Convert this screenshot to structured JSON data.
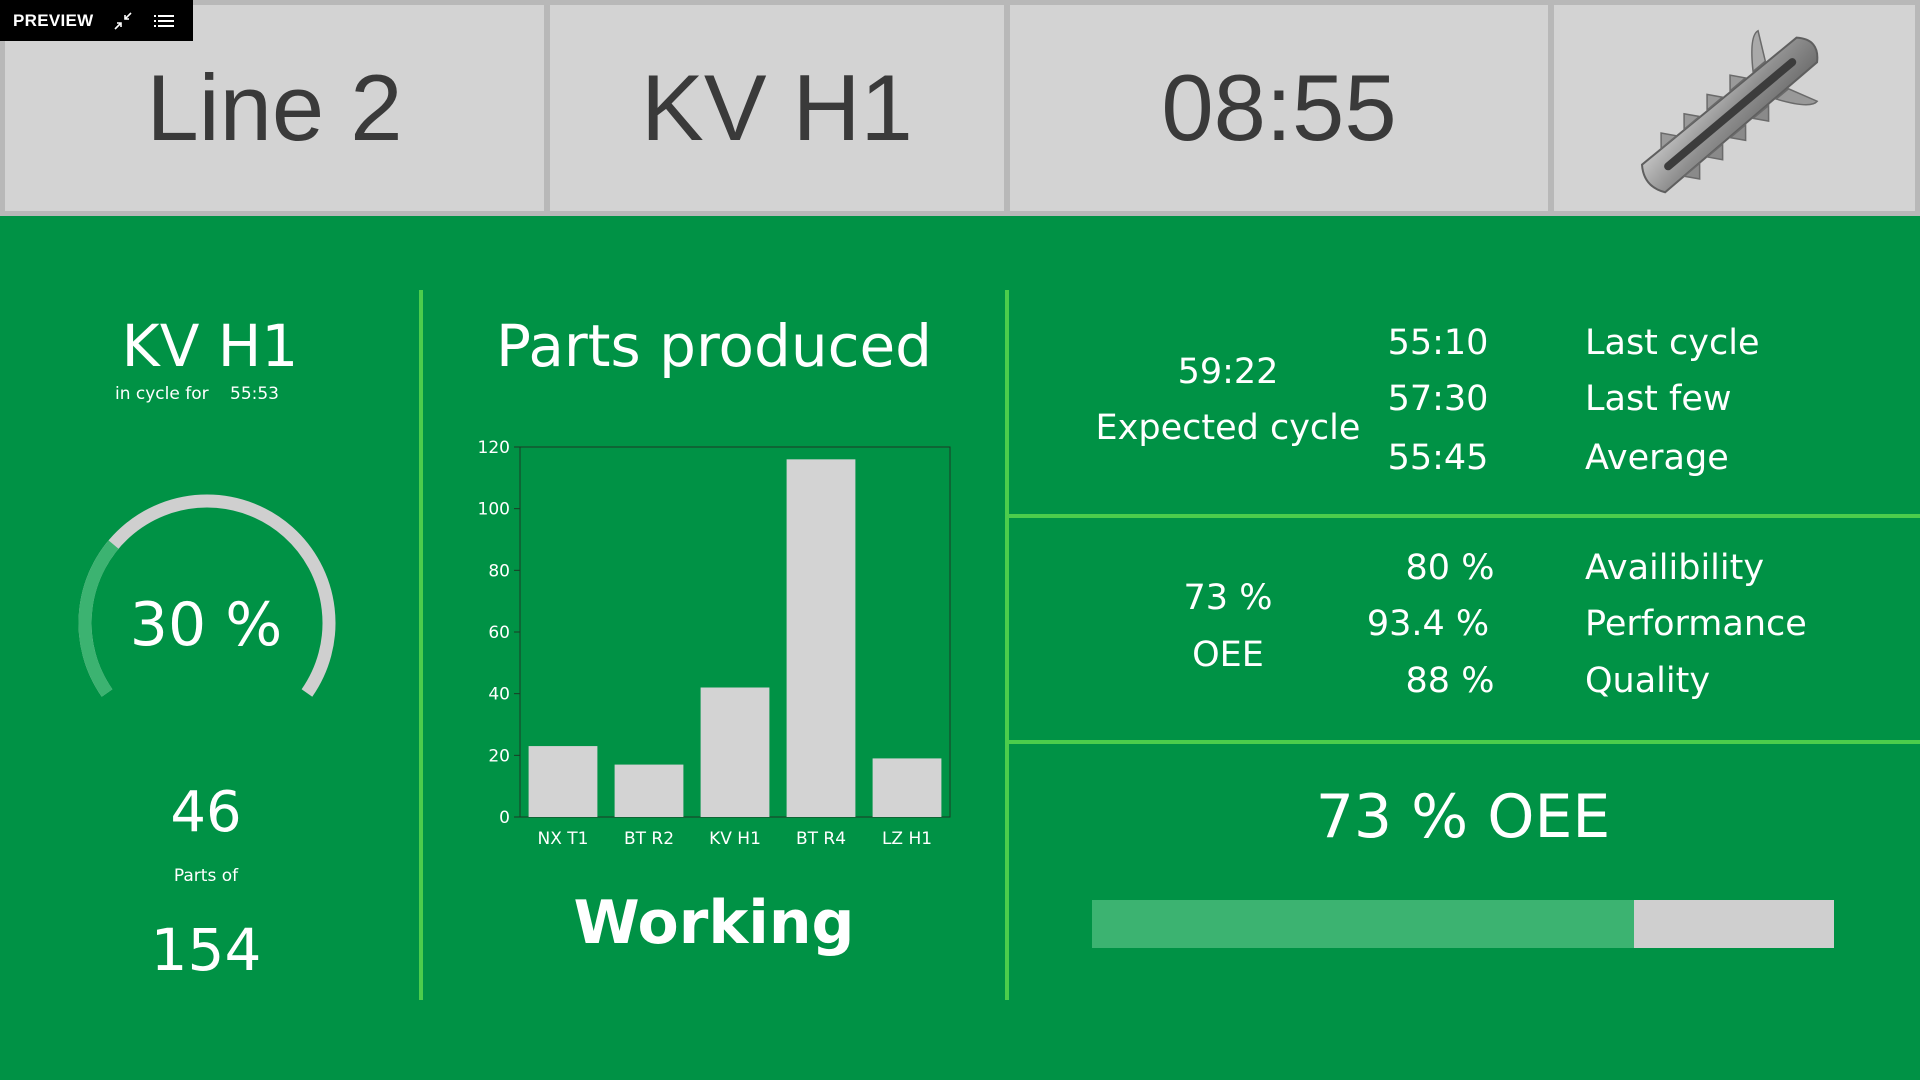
{
  "preview": {
    "label": "PREVIEW",
    "collapse_icon": "collapse-arrows-icon",
    "menu_icon": "list-icon"
  },
  "header": {
    "line": "Line 2",
    "machine": "KV H1",
    "time": "08:55",
    "part_image": "wall-plug-anchor"
  },
  "left": {
    "machine": "KV H1",
    "cycle_label": "in cycle for",
    "cycle_value": "55:53",
    "progress_text": "30 %",
    "progress_fraction": 0.3,
    "parts_count": "46",
    "parts_of_label": "Parts of",
    "parts_total": "154"
  },
  "middle": {
    "title": "Parts produced",
    "status": "Working"
  },
  "chart_data": {
    "type": "bar",
    "categories": [
      "NX T1",
      "BT R2",
      "KV H1",
      "BT R4",
      "LZ H1"
    ],
    "values": [
      23,
      17,
      42,
      116,
      19
    ],
    "ylim": [
      0,
      120
    ],
    "yticks": [
      "0",
      "20",
      "40",
      "60",
      "80",
      "100",
      "120"
    ],
    "grid": false,
    "legend": "none"
  },
  "cycle": {
    "expected_value": "59:22",
    "expected_label": "Expected cycle",
    "rows": [
      {
        "value": "55:10",
        "label": "Last cycle"
      },
      {
        "value": "57:30",
        "label": "Last few"
      },
      {
        "value": "55:45",
        "label": "Average"
      }
    ]
  },
  "oee": {
    "value": "73 %",
    "label": "OEE",
    "rows": [
      {
        "value": "80 %",
        "label": "Availibility"
      },
      {
        "value": "93.4 %",
        "label": "Performance"
      },
      {
        "value": "88 %",
        "label": "Quality"
      }
    ],
    "big_text": "73 % OEE",
    "bar_fraction": 0.73
  },
  "colors": {
    "background": "#009245",
    "divider": "#4ccd4c",
    "accent_fill": "#3cb371",
    "panel_grey": "#d3d3d3"
  }
}
